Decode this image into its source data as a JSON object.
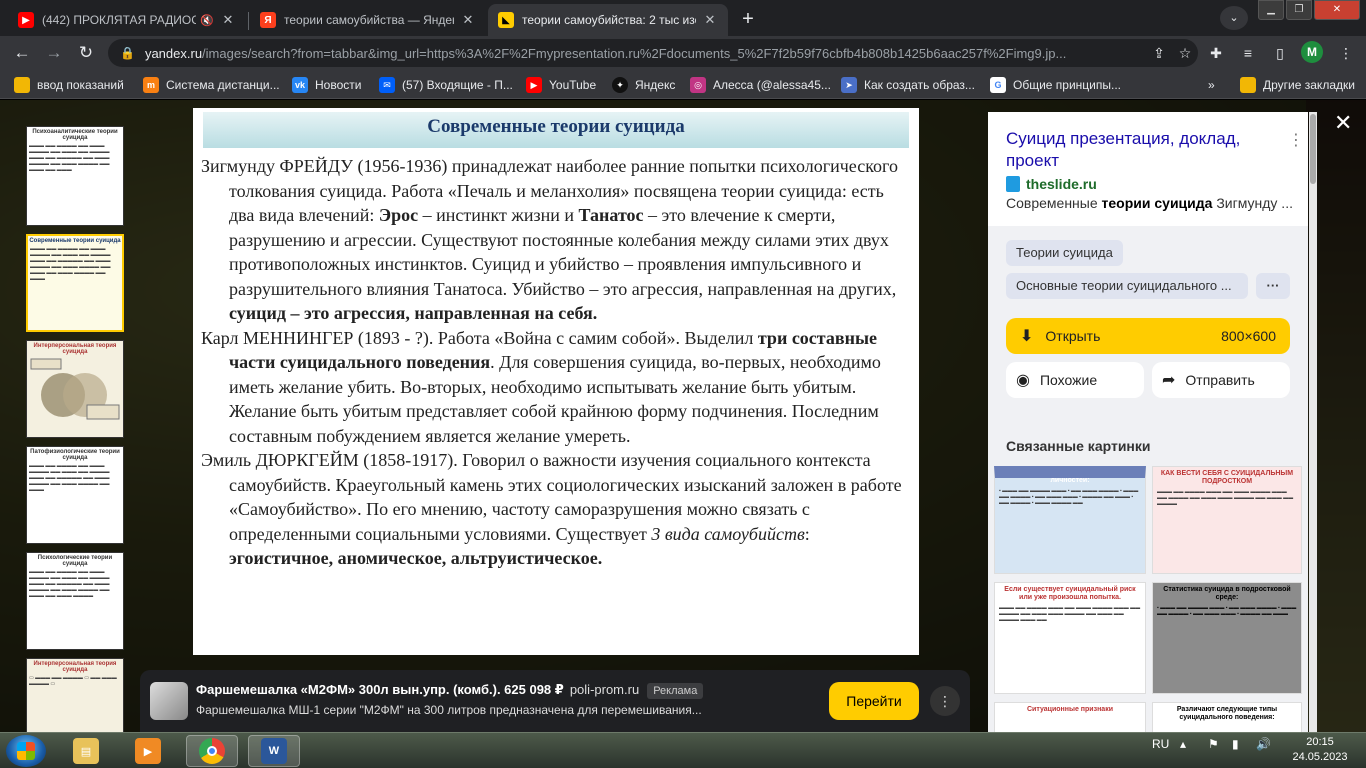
{
  "tabs": [
    {
      "title": "(442) ПРОКЛЯТАЯ РАДИОСТ",
      "favicon": "youtube-icon",
      "color": "#ff0000"
    },
    {
      "title": "теории самоубийства — Яндекс",
      "favicon": "yandex-icon",
      "color": "#fc3f1d"
    },
    {
      "title": "теории самоубийства: 2 тыс изо",
      "favicon": "yandex-images-icon",
      "color": "#ffcc00"
    }
  ],
  "address": {
    "host": "yandex.ru",
    "path": "/images/search?from=tabbar&img_url=https%3A%2F%2Fmypresentation.ru%2Fdocuments_5%2F7f2b59f76cbfb4b808b1425b6aac257f%2Fimg9.jp..."
  },
  "profile_letter": "M",
  "bookmarks": [
    {
      "label": "ввод показаний",
      "icon": "folder-icon",
      "color": "#f2b705"
    },
    {
      "label": "Система дистанци...",
      "icon": "moodle-icon",
      "color": "#f98012"
    },
    {
      "label": "Новости",
      "icon": "vk-icon",
      "color": "#2787f5"
    },
    {
      "label": "(57) Входящие - П...",
      "icon": "mail-icon",
      "color": "#005ff9"
    },
    {
      "label": "YouTube",
      "icon": "youtube-icon",
      "color": "#ff0000"
    },
    {
      "label": "Яндекс",
      "icon": "yandex-icon",
      "color": "#111111"
    },
    {
      "label": "Алесса (@alessa45...",
      "icon": "instagram-icon",
      "color": "#c13584"
    },
    {
      "label": "Как создать образ...",
      "icon": "rocket-icon",
      "color": "#4a6fc7"
    },
    {
      "label": "Общие принципы...",
      "icon": "google-icon",
      "color": "#4285f4"
    }
  ],
  "bookmarks_other": "Другие закладки",
  "slide": {
    "title": "Современные теории суицида",
    "p1": {
      "a": "Зигмунду ФРЕЙДУ (1956-1936) принадлежат наиболее ранние попытки психологического толкования суицида. Работа «Печаль и меланхолия» посвящена теории суицида: есть два вида влечений: ",
      "b1": "Эрос",
      "c": " – инстинкт жизни и ",
      "b2": "Танатос",
      "d": " – это влечение к смерти, разрушению и агрессии. Существуют постоянные колебания между силами этих двух противоположных инстинктов. Суицид и убийство – проявления импульсивного и разрушительного влияния Танатоса. Убийство – это агрессия, направленная на других, ",
      "b3": "суицид – это агрессия, направленная на себя."
    },
    "p2": {
      "a": "Карл МЕННИНГЕР (1893 - ?). Работа «Война с самим собой». Выделил ",
      "b1": "три составные части суицидального поведения",
      "c": ".  Для совершения суицида, во-первых, необходимо иметь желание убить. Во-вторых, необходимо испытывать желание быть убитым. Желание быть убитым представляет собой крайнюю форму подчинения. Последним составным побуждением является желание умереть."
    },
    "p3": {
      "a": "Эмиль ДЮРКГЕЙМ (1858-1917). Говорил о важности изучения социального контекста самоубийств. Краеугольный камень этих социологических изысканий заложен в работе «Самоубийство». По его мнению, частоту саморазрушения можно связать с определенными социальными условиями. Существует ",
      "i1": "3 вида самоубийств",
      "c": ": ",
      "b1": "эгоистичное, аномическое, альтруистическое."
    }
  },
  "thumbnails": [
    {
      "title": "Психоаналитические теории суицида"
    },
    {
      "title": "Современные теории суицида"
    },
    {
      "title": "Интерперсональная теория суицида"
    },
    {
      "title": "Патофизиологические теории суицида"
    },
    {
      "title": "Психологические теории суицида"
    },
    {
      "title": "Интерперсональная теория суицида"
    }
  ],
  "ad": {
    "title": "Фаршемешалка «М2ФМ» 300л вын.упр. (комб.). 625 098 ₽",
    "domain": "poli-prom.ru",
    "badge": "Реклама",
    "desc": "Фаршемешалка МШ-1 серии \"М2ФМ\" на 300 литров предназначена для перемешивания...",
    "cta": "Перейти"
  },
  "side": {
    "title": "Суицид презентация, доклад, проект",
    "source": "theslide.ru",
    "desc_pre": "Современные ",
    "desc_bold": "теории суицида",
    "desc_post": " Зигмунду ...",
    "chip1": "Теории суицида",
    "chip2": "Основные теории суицидального ...",
    "open_label": "Открыть",
    "size": "800×600",
    "similar": "Похожие",
    "share": "Отправить",
    "related_title": "Связанные картинки",
    "related": [
      {
        "title": "Характерные черты суицидальных личностей:"
      },
      {
        "title": "КАК ВЕСТИ СЕБЯ С СУИЦИДАЛЬНЫМ ПОДРОСТКОМ"
      },
      {
        "title": "Если существует суицидальный риск или уже произошла попытка."
      },
      {
        "title": "Статистика суицида в подростковой среде:"
      },
      {
        "title": "Ситуационные признаки"
      },
      {
        "title": "Различают следующие типы суицидального поведения:"
      }
    ]
  },
  "taskbar": {
    "lang": "RU",
    "time": "20:15",
    "date": "24.05.2023"
  }
}
